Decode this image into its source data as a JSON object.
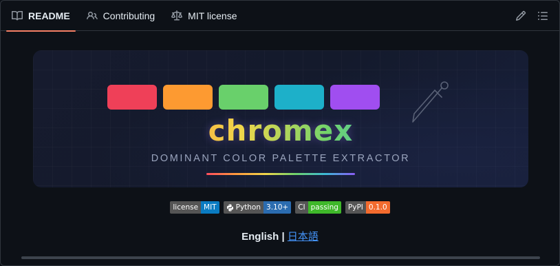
{
  "tabs": [
    {
      "label": "README",
      "icon": "book-icon",
      "active": true
    },
    {
      "label": "Contributing",
      "icon": "people-icon"
    },
    {
      "label": "MIT license",
      "icon": "law-icon"
    }
  ],
  "actions": {
    "edit_icon": "pencil-icon",
    "outline_icon": "list-icon"
  },
  "banner": {
    "title": "chromex",
    "subtitle": "DOMINANT COLOR PALETTE EXTRACTOR",
    "swatches": [
      "#ef4058",
      "#fd9a31",
      "#69d06b",
      "#1db0c9",
      "#a04ef0"
    ]
  },
  "badges": [
    {
      "key": "license",
      "value": "MIT",
      "color": "#0a7bc1"
    },
    {
      "key": "Python",
      "value": "3.10+",
      "color": "#2b6cb0",
      "icon": "python-icon"
    },
    {
      "key": "CI",
      "value": "passing",
      "color": "#3fb82a"
    },
    {
      "key": "PyPI",
      "value": "0.1.0",
      "color": "#f36b2e"
    }
  ],
  "languages": {
    "current": "English",
    "separator": " | ",
    "other": "日本語"
  }
}
